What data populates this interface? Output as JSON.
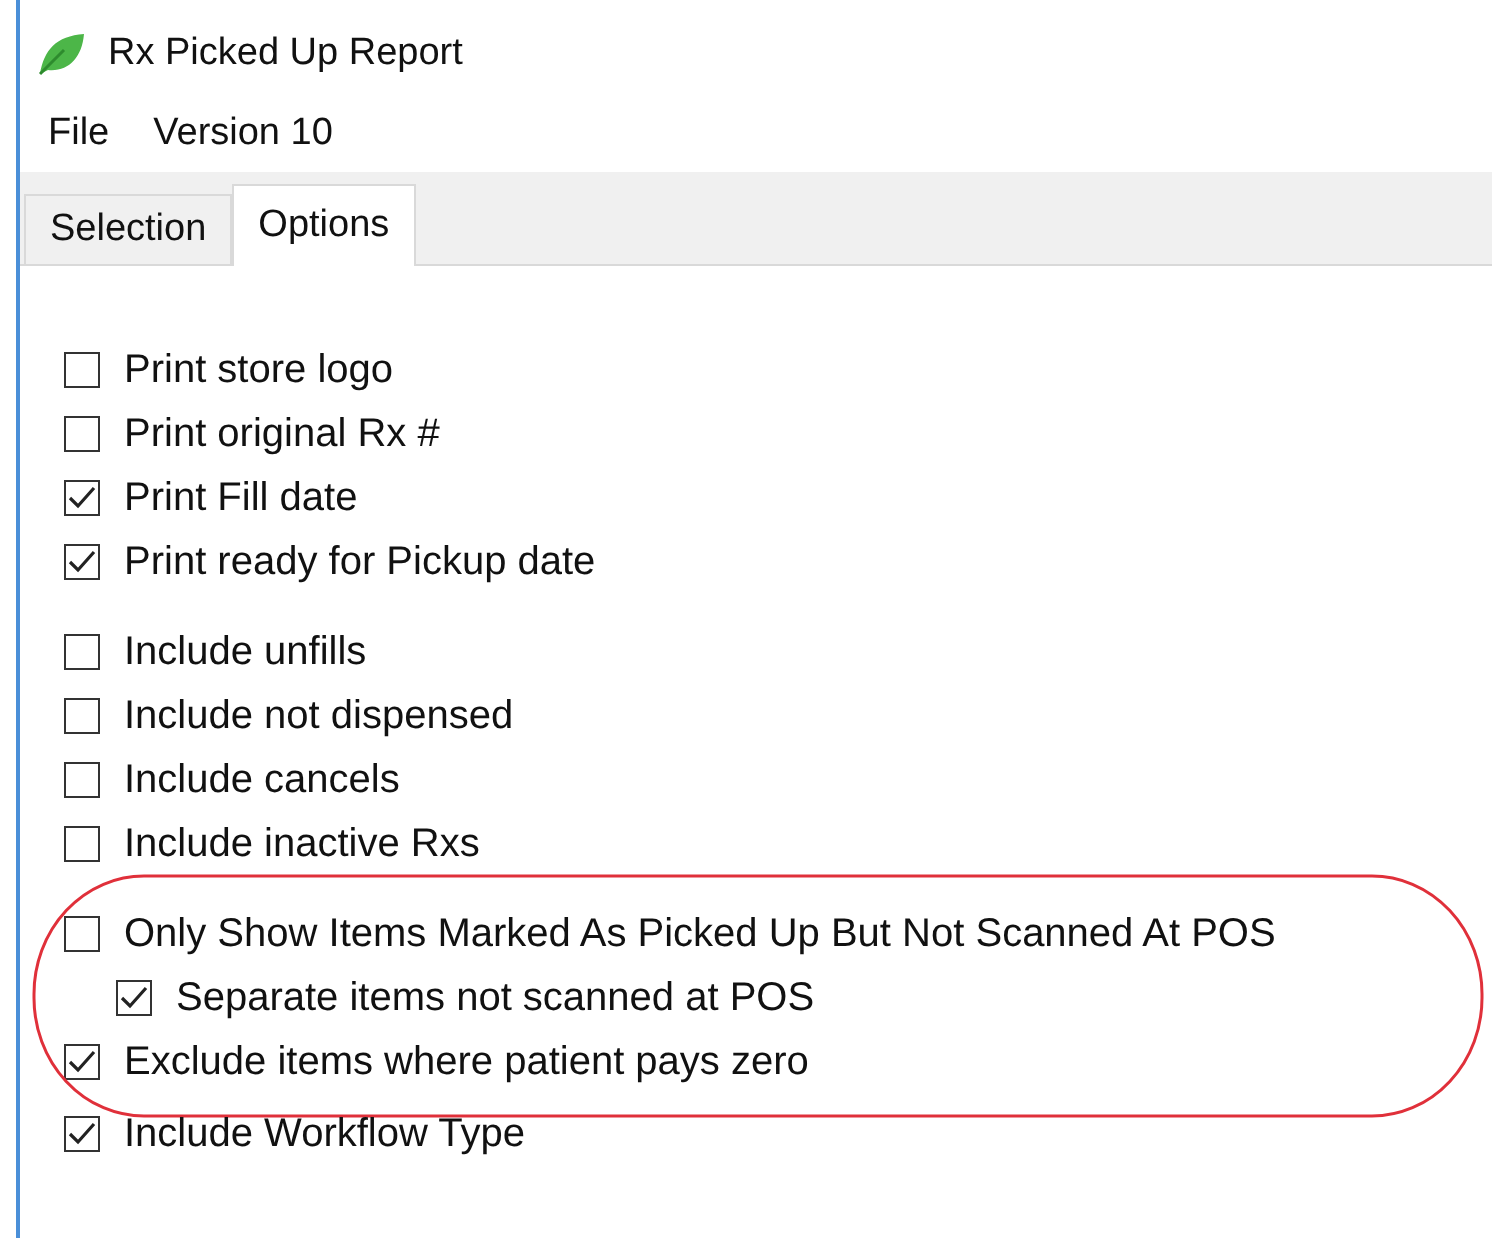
{
  "window": {
    "title": "Rx Picked Up Report"
  },
  "menu": [
    "File",
    "Version 10"
  ],
  "tabs": [
    {
      "label": "Selection",
      "selected": false
    },
    {
      "label": "Options",
      "selected": true
    }
  ],
  "groups": [
    {
      "circled": false,
      "items": [
        {
          "label": "Print store logo",
          "checked": false
        },
        {
          "label": "Print original Rx #",
          "checked": false
        },
        {
          "label": "Print Fill date",
          "checked": true
        },
        {
          "label": "Print ready for Pickup date",
          "checked": true
        }
      ]
    },
    {
      "circled": false,
      "items": [
        {
          "label": "Include unfills",
          "checked": false
        },
        {
          "label": "Include not dispensed",
          "checked": false
        },
        {
          "label": "Include cancels",
          "checked": false
        },
        {
          "label": "Include inactive Rxs",
          "checked": false
        }
      ]
    },
    {
      "circled": true,
      "items": [
        {
          "label": "Only Show Items Marked As Picked Up But Not Scanned At POS",
          "checked": false,
          "children": [
            {
              "label": "Separate items not scanned at POS",
              "checked": true
            }
          ]
        },
        {
          "label": "Exclude items where patient pays zero",
          "checked": true
        }
      ]
    },
    {
      "circled": false,
      "items": [
        {
          "label": "Include Workflow Type",
          "checked": true
        }
      ]
    }
  ]
}
